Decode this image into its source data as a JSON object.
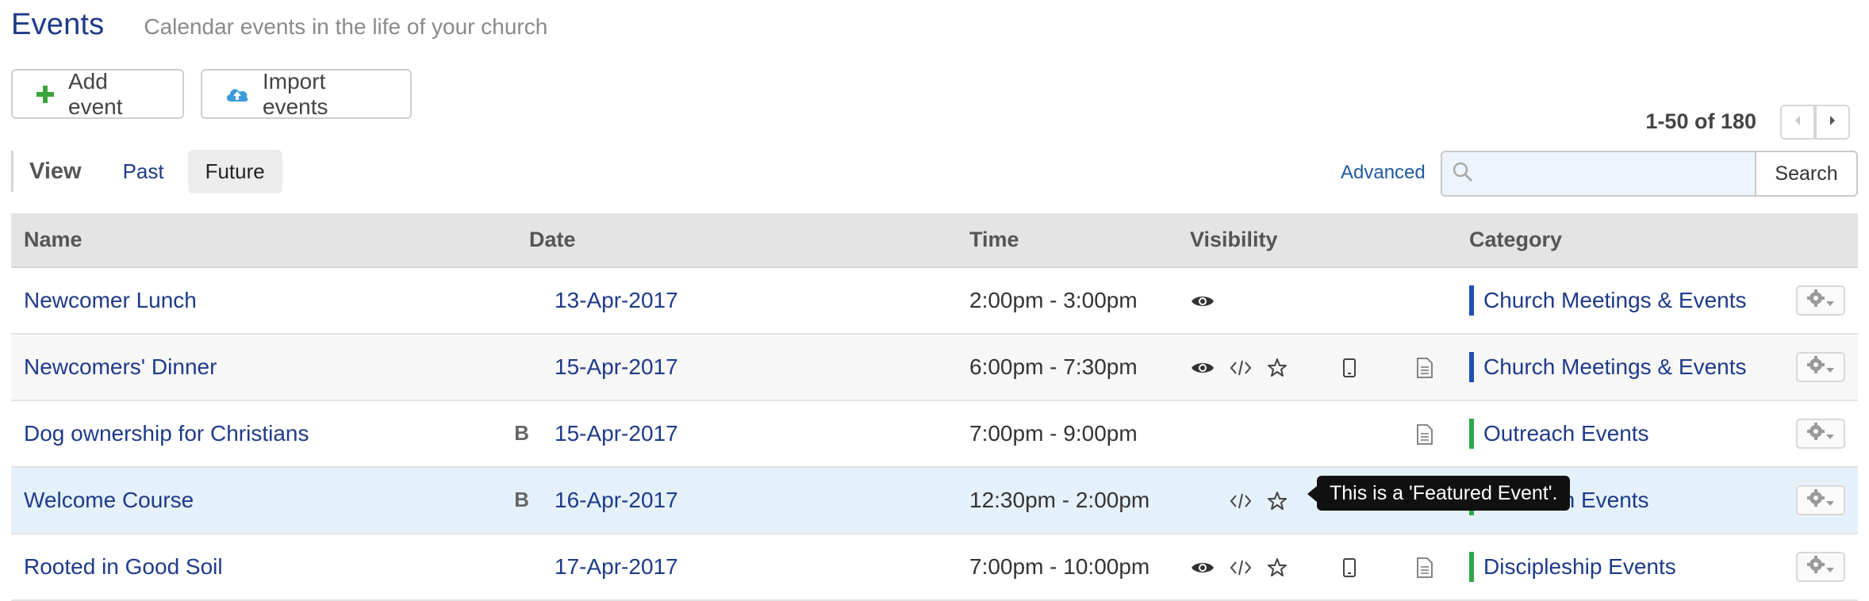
{
  "header": {
    "title": "Events",
    "subtitle": "Calendar events in the life of your church"
  },
  "toolbar": {
    "add_label": "Add event",
    "import_label": "Import events"
  },
  "pager": {
    "range_text": "1-50 of 180"
  },
  "view": {
    "label": "View",
    "tabs": [
      {
        "label": "Past",
        "active": false
      },
      {
        "label": "Future",
        "active": true
      }
    ]
  },
  "search": {
    "advanced_label": "Advanced",
    "placeholder": "",
    "button_label": "Search"
  },
  "table": {
    "columns": [
      "Name",
      "Date",
      "Time",
      "Visibility",
      "Category"
    ],
    "rows": [
      {
        "name": "Newcomer Lunch",
        "booking": "",
        "date": "13-Apr-2017",
        "time": "2:00pm - 3:00pm",
        "visibility": [
          "eye-icon"
        ],
        "category": "Church Meetings & Events",
        "category_color": "#1f4fb5"
      },
      {
        "name": "Newcomers' Dinner",
        "booking": "",
        "date": "15-Apr-2017",
        "time": "6:00pm - 7:30pm",
        "visibility": [
          "eye-icon",
          "code-icon",
          "star-icon",
          "mobile-icon",
          "document-icon"
        ],
        "category": "Church Meetings & Events",
        "category_color": "#1f4fb5"
      },
      {
        "name": "Dog ownership for Christians",
        "booking": "B",
        "date": "15-Apr-2017",
        "time": "7:00pm - 9:00pm",
        "visibility": [
          "document-icon"
        ],
        "category": "Outreach Events",
        "category_color": "#2ea84a"
      },
      {
        "name": "Welcome Course",
        "booking": "B",
        "date": "16-Apr-2017",
        "time": "12:30pm - 2:00pm",
        "visibility": [
          "code-icon",
          "star-icon"
        ],
        "category": "Outreach Events",
        "category_color": "#2ea84a"
      },
      {
        "name": "Rooted in Good Soil",
        "booking": "",
        "date": "17-Apr-2017",
        "time": "7:00pm - 10:00pm",
        "visibility": [
          "eye-icon",
          "code-icon",
          "star-icon",
          "mobile-icon",
          "document-icon"
        ],
        "category": "Discipleship Events",
        "category_color": "#2ea84a"
      }
    ]
  },
  "tooltip": {
    "text": "This is a 'Featured Event'."
  },
  "colors": {
    "link": "#1e3a8a",
    "add_icon": "#3aa53a",
    "import_icon": "#3a9bd9"
  }
}
